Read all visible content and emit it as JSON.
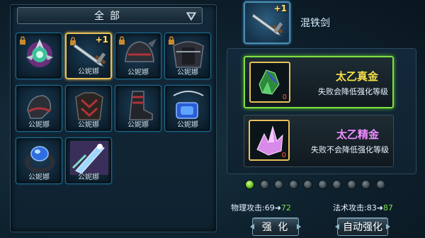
{
  "filter": {
    "label": "全部"
  },
  "equipment": [
    {
      "owner": "",
      "plus": "",
      "art": "shield-emblem"
    },
    {
      "owner": "公妮娜",
      "plus": "+1",
      "art": "sword"
    },
    {
      "owner": "公妮娜",
      "plus": "",
      "art": "helmet-dark"
    },
    {
      "owner": "公妮娜",
      "plus": "",
      "art": "armor-dark"
    },
    {
      "owner": "公妮娜",
      "plus": "",
      "art": "pauldron"
    },
    {
      "owner": "公妮娜",
      "plus": "",
      "art": "chest-armor"
    },
    {
      "owner": "公妮娜",
      "plus": "",
      "art": "boot-red"
    },
    {
      "owner": "公妮娜",
      "plus": "",
      "art": "necklace"
    },
    {
      "owner": "公妮娜",
      "plus": "",
      "art": "ring-blue"
    },
    {
      "owner": "公妮娜",
      "plus": "",
      "art": "crystal-blade"
    }
  ],
  "selected": {
    "name": "混铁剑",
    "plus": "+1"
  },
  "materials": [
    {
      "name": "太乙真金",
      "desc": "失败会降低强化等级",
      "count": "0",
      "color": "#f6e04a",
      "active": true
    },
    {
      "name": "太乙精金",
      "desc": "失败不会降低强化等级",
      "count": "0",
      "color": "#f08cff",
      "active": false
    }
  ],
  "progress": {
    "level": 1,
    "max": 10
  },
  "stats": {
    "physical": {
      "label": "物理攻击:69",
      "new": "72"
    },
    "magic": {
      "label": "法术攻击:83",
      "new": "87"
    }
  },
  "buttons": {
    "enhance": "强 化",
    "auto_enhance": "自动强化"
  },
  "colors": {
    "selected_border": "#e8c15a",
    "active_material": "#7fe041",
    "stat_up": "#7ae04a",
    "slot_border": "#1f6d91"
  }
}
